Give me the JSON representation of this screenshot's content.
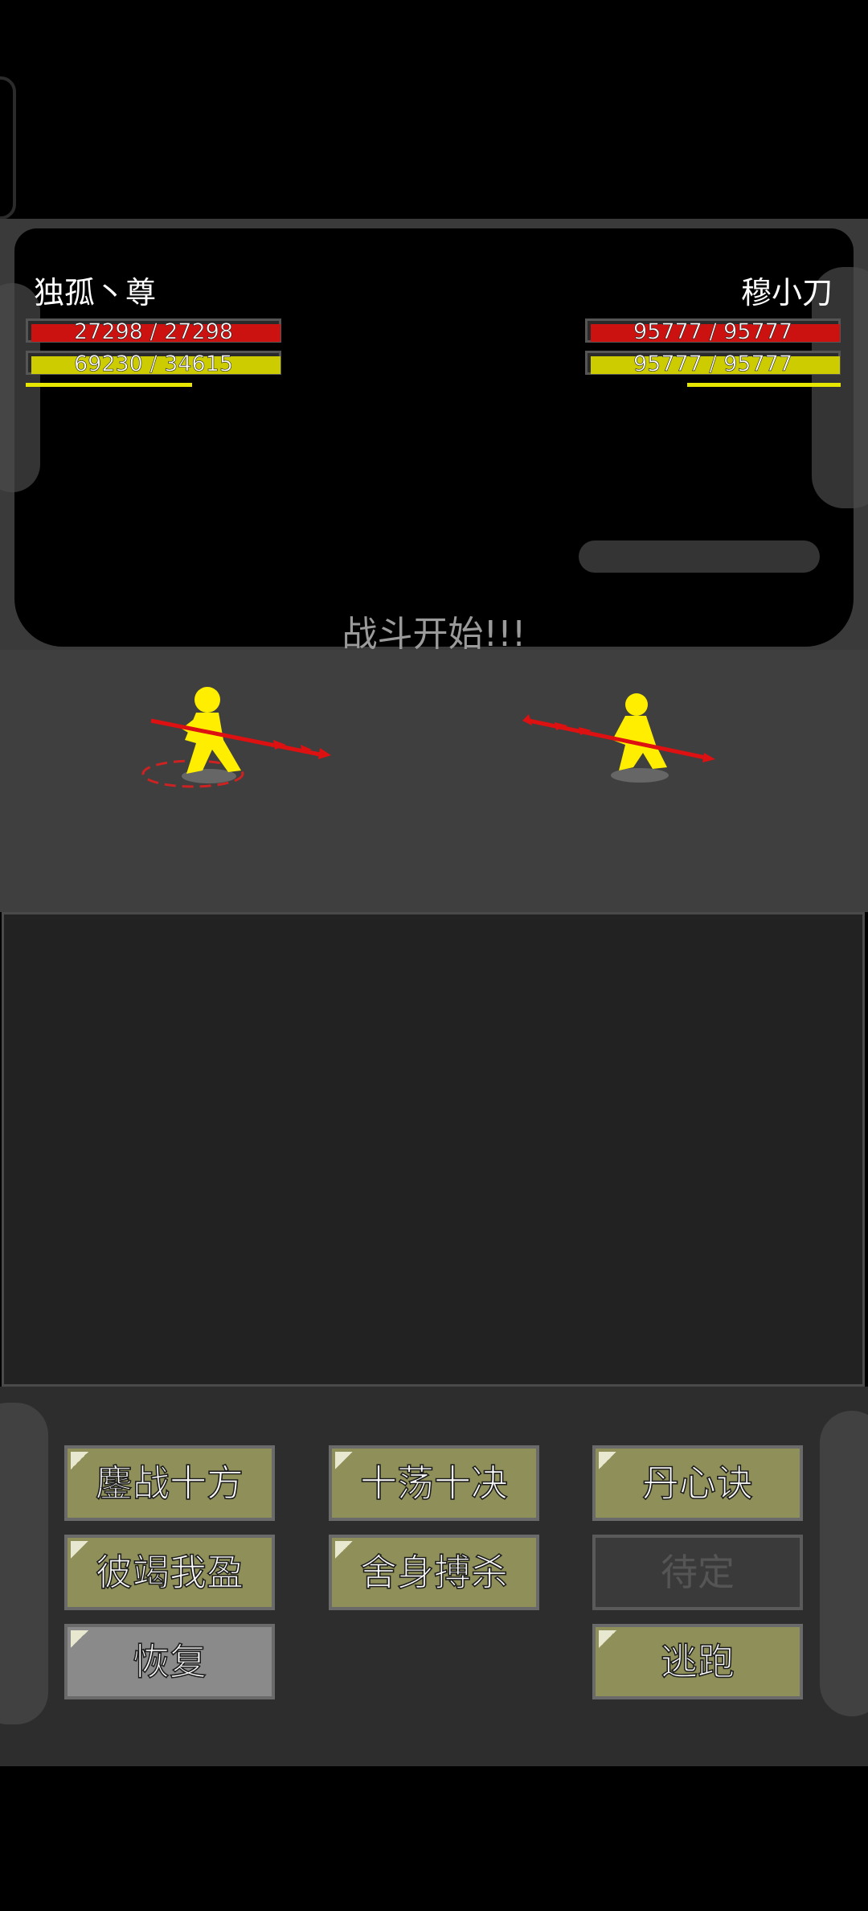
{
  "player": {
    "name": "独孤丶尊",
    "hp": {
      "current": 27298,
      "max": 27298,
      "label": "27298 / 27298"
    },
    "mp": {
      "current": 69230,
      "max": 34615,
      "label": "69230 / 34615"
    },
    "energy_fraction": 0.65
  },
  "enemy": {
    "name": "穆小刀",
    "hp": {
      "current": 95777,
      "max": 95777,
      "label": "95777 / 95777"
    },
    "mp": {
      "current": 95777,
      "max": 95777,
      "label": "95777 / 95777"
    },
    "energy_fraction": 0.6
  },
  "battle_message": "战斗开始!!!",
  "skills": [
    {
      "label": "鏖战十方",
      "state": "active"
    },
    {
      "label": "十荡十决",
      "state": "active"
    },
    {
      "label": "丹心诀",
      "state": "active"
    },
    {
      "label": "彼竭我盈",
      "state": "active"
    },
    {
      "label": "舍身搏杀",
      "state": "active"
    },
    {
      "label": "待定",
      "state": "disabled"
    },
    {
      "label": "恢复",
      "state": "gray"
    },
    {
      "label": "逃跑",
      "state": "active"
    }
  ],
  "colors": {
    "hp_bar": "#cc1111",
    "mp_bar": "#cccc00",
    "fighter": "#ffee00",
    "spear": "#dd1111",
    "skill_button": "#8f8f59"
  }
}
